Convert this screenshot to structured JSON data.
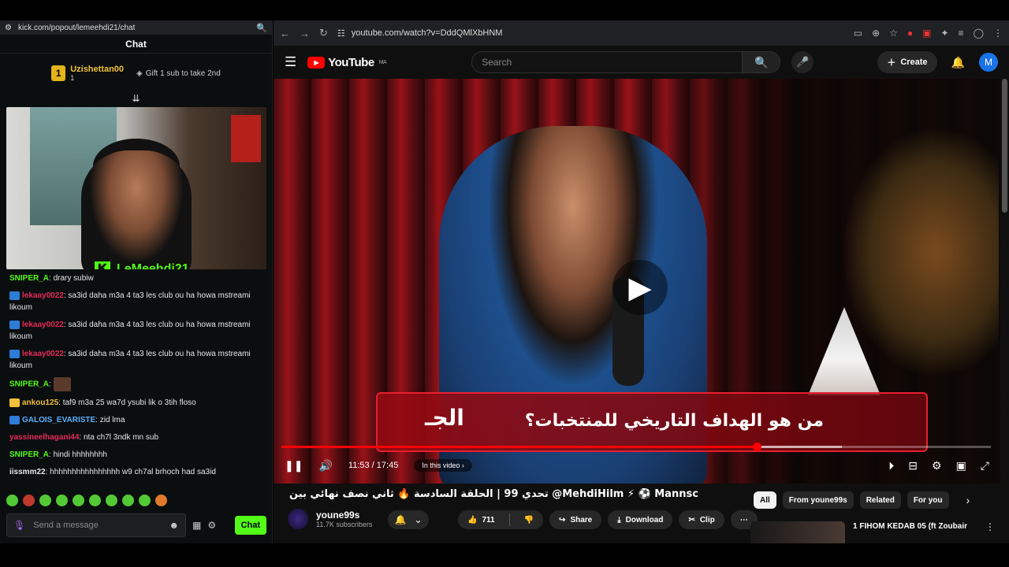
{
  "kick": {
    "url": "kick.com/popout/lemeehdi21/chat",
    "header": "Chat",
    "top_gifter": {
      "rank": "1",
      "name": "Uzishettan00",
      "count": "1",
      "gift_note": "Gift 1 sub to take 2nd"
    },
    "streamer_overlay": "LeMeehdi21",
    "messages": [
      {
        "user": "SNIPER_A",
        "user_color": "#53fc18",
        "badge": "",
        "text": "drary subiw"
      },
      {
        "user": "lekaay0022",
        "user_color": "#e8295b",
        "badge": "blue",
        "text": "sa3id daha m3a 4 ta3 les club ou ha howa mstreami likoum"
      },
      {
        "user": "lekaay0022",
        "user_color": "#e8295b",
        "badge": "blue",
        "text": "sa3id daha m3a 4 ta3 les club ou ha howa mstreami likoum"
      },
      {
        "user": "lekaay0022",
        "user_color": "#e8295b",
        "badge": "blue",
        "text": "sa3id daha m3a 4 ta3 les club ou ha howa mstreami likoum"
      },
      {
        "user": "SNIPER_A",
        "user_color": "#53fc18",
        "badge": "",
        "text": "",
        "emote": true
      },
      {
        "user": "ankou125",
        "user_color": "#f2c038",
        "badge": "yellow",
        "text": "taf9 m3a 25 wa7d ysubi lik o 3tih floso"
      },
      {
        "user": "GALOIS_EVARISTE",
        "user_color": "#5ab0ff",
        "badge": "blue",
        "text": "zid lma"
      },
      {
        "user": "yassineelhagani44",
        "user_color": "#e8295b",
        "badge": "",
        "text": "nta ch7l 3ndk mn sub"
      },
      {
        "user": "SNIPER_A",
        "user_color": "#53fc18",
        "badge": "",
        "text": "hindi hhhhhhhh"
      },
      {
        "user": "iissmm22",
        "user_color": "#e6e6e6",
        "badge": "",
        "text": "hhhhhhhhhhhhhhhh w9 ch7al brhoch had sa3id"
      }
    ],
    "composer_placeholder": "Send a message",
    "chat_button": "Chat"
  },
  "browser": {
    "url": "youtube.com/watch?v=DddQMlXbHNM"
  },
  "youtube": {
    "logo": "YouTube",
    "region": "MA",
    "search_placeholder": "Search",
    "create_label": "Create",
    "avatar_letter": "M",
    "video": {
      "banner_question": "من هو الهداف التاريخي للمنتخبات؟",
      "banner_logo": "الجـ",
      "current_time": "11:53",
      "duration": "17:45",
      "time_display": "11:53 / 17:45",
      "progress": 0.67,
      "buffered": 0.79,
      "chapter_label": "In this video",
      "title": "تحدي 99 | الحلقة السادسة 🔥 ثاني نصف نهائي بين @MehdiHilm ⚡ ⚽ Mannschaft SALAH و"
    },
    "channel": {
      "name": "youne99s",
      "subscribers": "11.7K subscribers"
    },
    "actions": {
      "likes": "711",
      "share": "Share",
      "download": "Download",
      "clip": "Clip"
    },
    "chips": [
      "All",
      "From youne99s",
      "Related",
      "For you"
    ],
    "recommendation": {
      "title": "1 FIHOM KEDAB 05 (ft Zoubair"
    }
  }
}
